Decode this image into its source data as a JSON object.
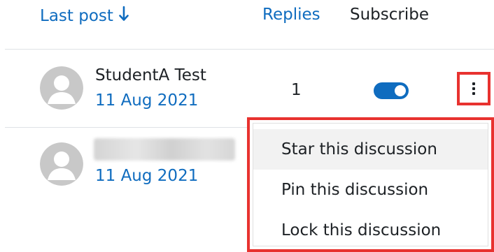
{
  "header": {
    "last_post_label": "Last post",
    "sort_icon": "arrow-down-icon",
    "replies_label": "Replies",
    "subscribe_label": "Subscribe"
  },
  "rows": [
    {
      "author": "StudentA Test",
      "date": "11 Aug 2021",
      "replies": "1",
      "subscribed": true,
      "avatar_icon": "user-avatar-icon"
    },
    {
      "author": "",
      "author_blurred": true,
      "date": "11 Aug 2021",
      "avatar_icon": "user-avatar-icon"
    }
  ],
  "actions_menu": {
    "trigger_icon": "kebab-menu-icon",
    "items": [
      {
        "label": "Star this discussion"
      },
      {
        "label": "Pin this discussion"
      },
      {
        "label": "Lock this discussion"
      }
    ]
  },
  "colors": {
    "link": "#0f6cbf",
    "highlight_outline": "#e8322f",
    "toggle_on": "#0f6cbf"
  }
}
